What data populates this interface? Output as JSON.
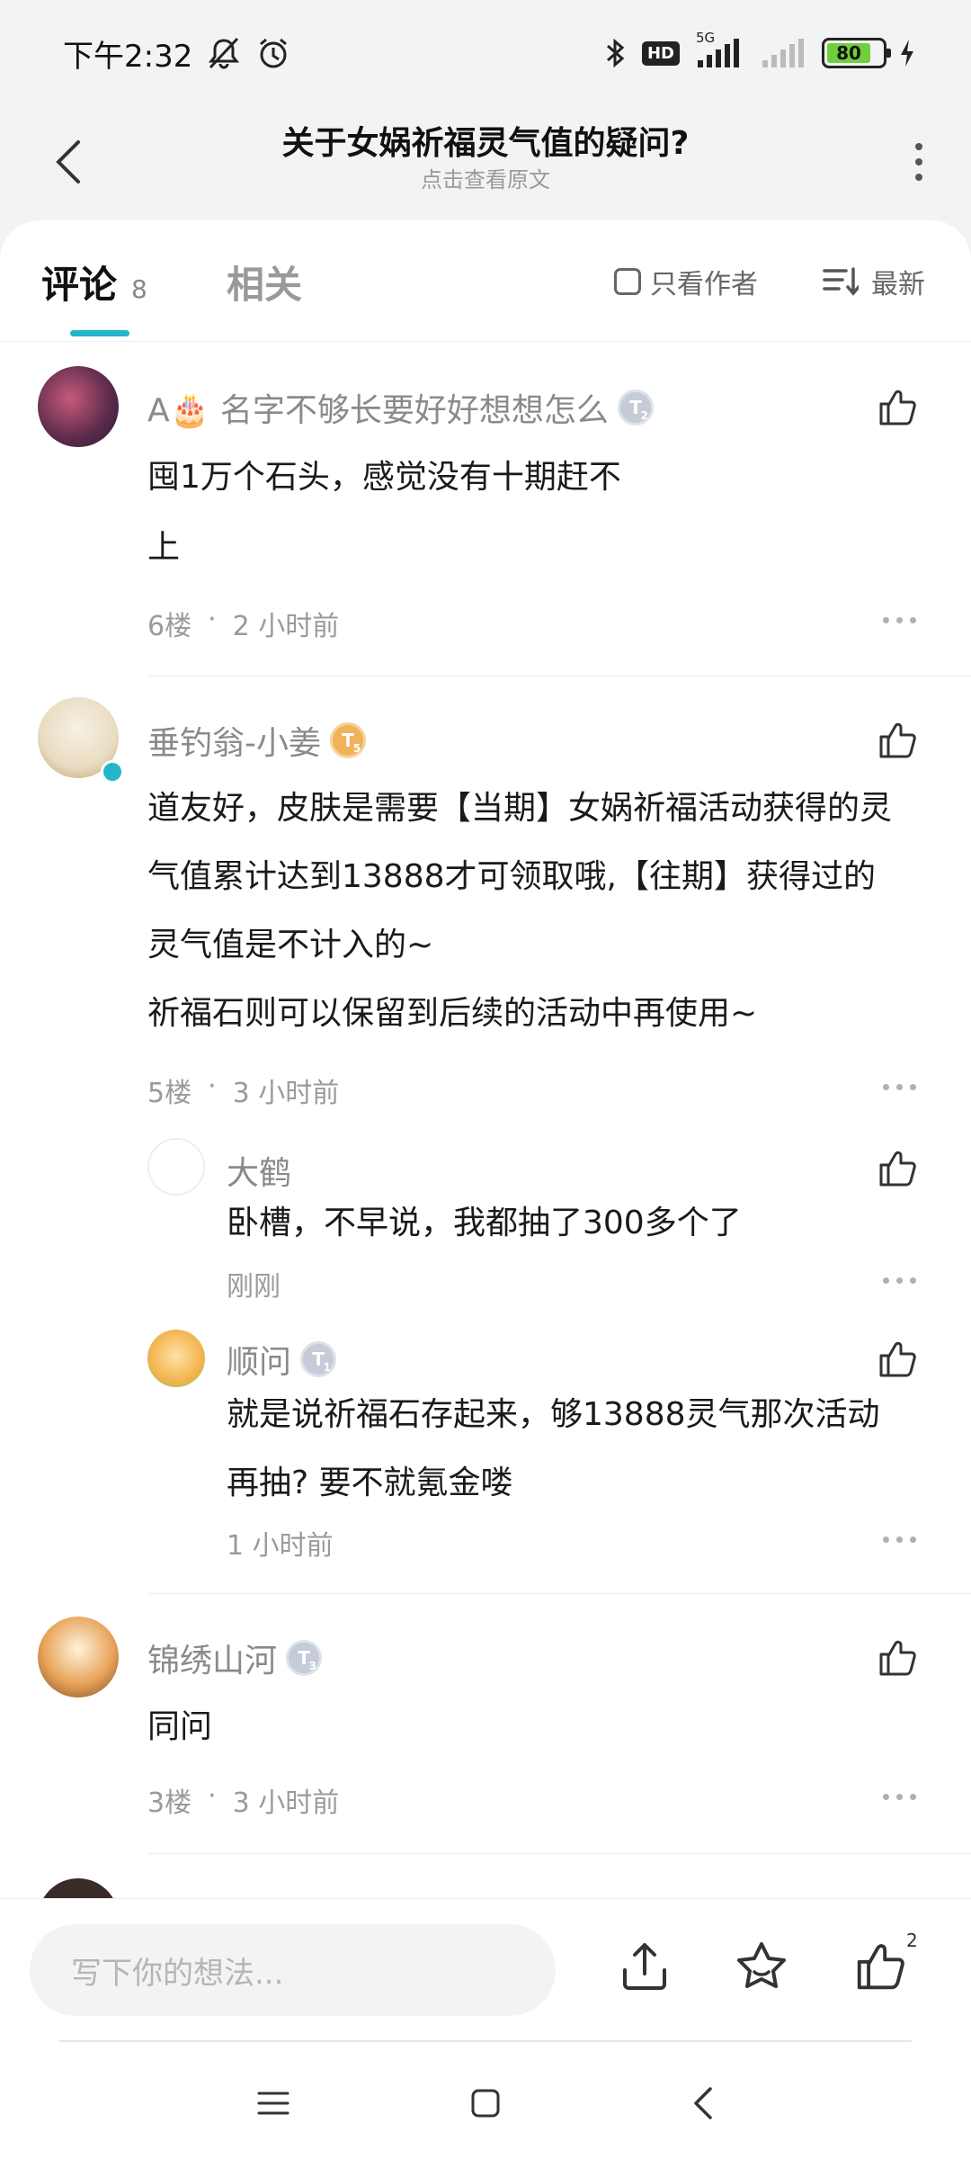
{
  "status_bar": {
    "time": "下午2:32",
    "network": "5G",
    "hd": "HD",
    "battery": "80"
  },
  "header": {
    "title": "关于女娲祈福灵气值的疑问?",
    "subtitle": "点击查看原文"
  },
  "tabs": {
    "comments_label": "评论",
    "comments_count": "8",
    "related_label": "相关",
    "author_only_label": "只看作者",
    "sort_label": "最新"
  },
  "comments": [
    {
      "user": "A🎂 名字不够长要好好想想怎么",
      "level": "T",
      "level_num": "2",
      "lines": [
        "囤1万个石头，感觉没有十期赶不",
        "上"
      ],
      "floor": "6楼",
      "time": "2 小时前"
    },
    {
      "user": "垂钓翁-小姜",
      "level": "T",
      "level_num": "5",
      "lines": [
        "道友好，皮肤是需要【当期】女娲祈福活动获得的灵",
        "气值累计达到13888才可领取哦,【往期】获得过的",
        "灵气值是不计入的~",
        "祈福石则可以保留到后续的活动中再使用~"
      ],
      "floor": "5楼",
      "time": "3 小时前",
      "replies": [
        {
          "user": "大鹤",
          "lines": [
            "卧槽，不早说，我都抽了300多个了"
          ],
          "time": "刚刚"
        },
        {
          "user": "顺问",
          "level": "T",
          "level_num": "1",
          "lines": [
            "就是说祈福石存起来，够13888灵气那次活动",
            "再抽? 要不就氪金喽"
          ],
          "time": "1 小时前"
        }
      ]
    },
    {
      "user": "锦绣山河",
      "level": "T",
      "level_num": "3",
      "lines": [
        "同问"
      ],
      "floor": "3楼",
      "time": "3 小时前"
    }
  ],
  "separator": "·",
  "bottom_bar": {
    "input_placeholder": "写下你的想法...",
    "like_count": "2"
  },
  "colors": {
    "accent": "#22b6c8",
    "verified": "#22b6c8",
    "battery": "#6fcf3b"
  }
}
